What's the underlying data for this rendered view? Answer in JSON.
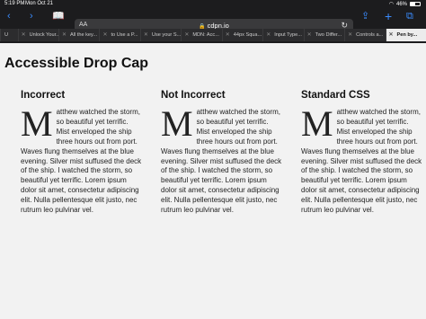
{
  "status": {
    "time": "5:19 PM",
    "date": "Mon Oct 21",
    "battery": "46%",
    "battery_level": 0.46
  },
  "toolbar": {
    "text_size_label": "AA",
    "host": "cdpn.io"
  },
  "tabs": [
    {
      "label": "U",
      "active": false
    },
    {
      "label": "Unlock Your...",
      "active": false
    },
    {
      "label": "All the key...",
      "active": false
    },
    {
      "label": "to Use a P...",
      "active": false
    },
    {
      "label": "Use your S...",
      "active": false
    },
    {
      "label": "MDN: Acc...",
      "active": false
    },
    {
      "label": "44px Squa...",
      "active": false
    },
    {
      "label": "Input Type...",
      "active": false
    },
    {
      "label": "Two Differ...",
      "active": false
    },
    {
      "label": "Controls a...",
      "active": false
    },
    {
      "label": "Pen by...",
      "active": true
    }
  ],
  "page": {
    "title": "Accessible Drop Cap",
    "columns": [
      {
        "heading": "Incorrect",
        "cap": "M",
        "text": "atthew watched the storm, so beautiful yet terrific. Mist enveloped the ship three hours out from port. Waves flung themselves at the blue evening. Silver mist suffused the deck of the ship. I watched the storm, so beautiful yet terrific. Lorem ipsum dolor sit amet, consectetur adipiscing elit. Nulla pellentesque elit justo, nec rutrum leo pulvinar vel."
      },
      {
        "heading": "Not Incorrect",
        "cap": "M",
        "text": "atthew watched the storm, so beautiful yet terrific. Mist enveloped the ship three hours out from port. Waves flung themselves at the blue evening. Silver mist suffused the deck of the ship. I watched the storm, so beautiful yet terrific. Lorem ipsum dolor sit amet, consectetur adipiscing elit. Nulla pellentesque elit justo, nec rutrum leo pulvinar vel."
      },
      {
        "heading": "Standard CSS",
        "cap": "M",
        "text": "atthew watched the storm, so beautiful yet terrific. Mist enveloped the ship three hours out from port. Waves flung themselves at the blue evening. Silver mist suffused the deck of the ship. I watched the storm, so beautiful yet terrific. Lorem ipsum dolor sit amet, consectetur adipiscing elit. Nulla pellentesque elit justo, nec rutrum leo pulvinar vel."
      }
    ]
  },
  "icons": {
    "back": "chevron-left-icon",
    "forward": "chevron-right-icon",
    "bookmarks": "book-icon",
    "lock": "lock-icon",
    "reload": "reload-icon",
    "share": "share-icon",
    "new_tab": "plus-icon",
    "tabs": "tabs-icon"
  },
  "colors": {
    "accent": "#3a8cff",
    "chrome": "#1c1c1e",
    "page_bg": "#f2f2f2"
  }
}
